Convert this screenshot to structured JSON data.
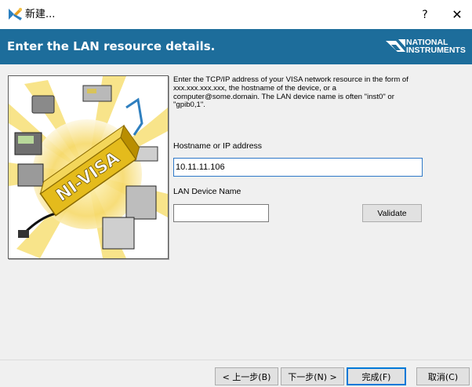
{
  "window": {
    "title": "新建...",
    "help_label": "?",
    "close_label": "✕",
    "icon": "ni-wizard-icon"
  },
  "header": {
    "title": "Enter the LAN resource details.",
    "logo_line1": "NATIONAL",
    "logo_line2": "INSTRUMENTS",
    "background": "#1d6d9b"
  },
  "illustration": {
    "banner_text": "NI-VISA",
    "icon": "ni-visa-illustration"
  },
  "form": {
    "description": "Enter the TCP/IP address of your VISA network resource in the form of xxx.xxx.xxx.xxx, the hostname of the device, or a computer@some.domain. The LAN device name is often \"inst0\" or \"gpib0,1\".",
    "hostname_label": "Hostname or IP address",
    "hostname_value": "10.11.11.106",
    "lan_device_label": "LAN Device Name",
    "lan_device_value": "",
    "validate_label": "Validate"
  },
  "footer": {
    "back_label": "< 上一步(B)",
    "next_label": "下一步(N) >",
    "finish_label": "完成(F)",
    "cancel_label": "取消(C)"
  }
}
